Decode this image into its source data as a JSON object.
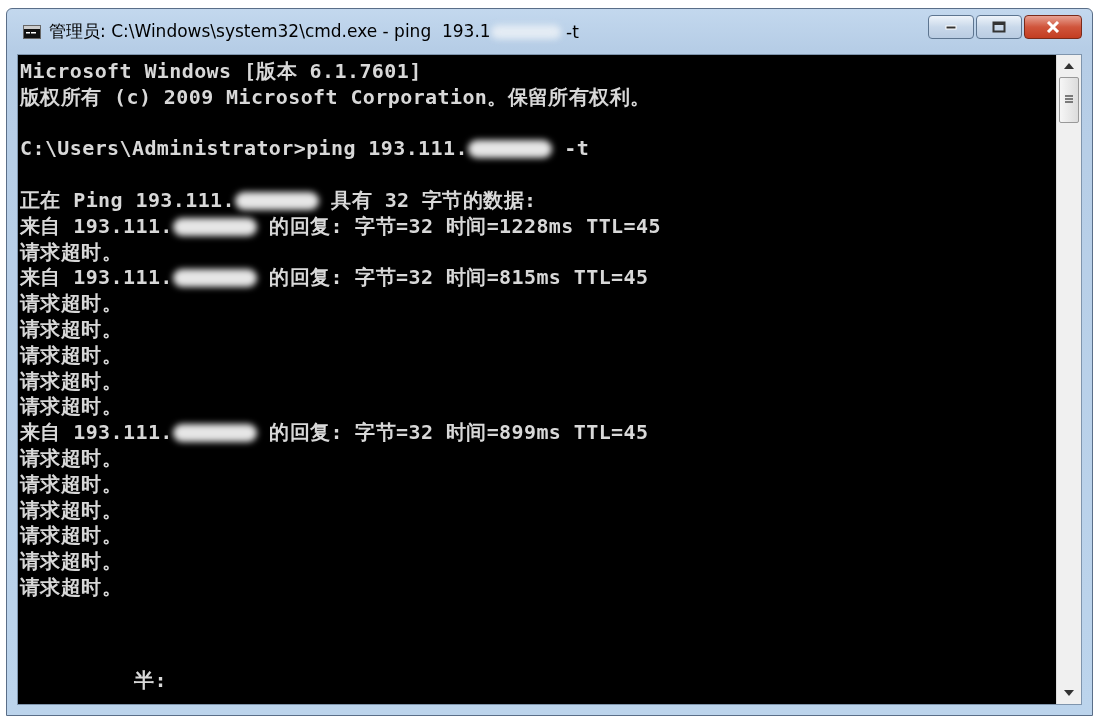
{
  "window": {
    "title": [
      {
        "kind": "text",
        "text": "管理员: C:\\Windows\\system32\\cmd.exe - ping  193.1"
      },
      {
        "kind": "redaction"
      },
      {
        "kind": "text",
        "text": " -t"
      }
    ]
  },
  "console": {
    "lines": [
      {
        "kind": "line",
        "segments": [
          {
            "kind": "text",
            "text": "Microsoft Windows [版本 6.1.7601]"
          }
        ]
      },
      {
        "kind": "line",
        "segments": [
          {
            "kind": "text",
            "text": "版权所有 (c) 2009 Microsoft Corporation。保留所有权利。"
          }
        ]
      },
      {
        "kind": "blank"
      },
      {
        "kind": "line",
        "segments": [
          {
            "kind": "text",
            "text": "C:\\Users\\Administrator>ping 193.111."
          },
          {
            "kind": "redaction"
          },
          {
            "kind": "text",
            "text": " -t"
          }
        ]
      },
      {
        "kind": "blank"
      },
      {
        "kind": "line",
        "segments": [
          {
            "kind": "text",
            "text": "正在 Ping 193.111."
          },
          {
            "kind": "redaction"
          },
          {
            "kind": "text",
            "text": " 具有 32 字节的数据:"
          }
        ]
      },
      {
        "kind": "line",
        "segments": [
          {
            "kind": "text",
            "text": "来自 193.111."
          },
          {
            "kind": "redaction"
          },
          {
            "kind": "text",
            "text": " 的回复: 字节=32 时间=1228ms TTL=45"
          }
        ]
      },
      {
        "kind": "line",
        "segments": [
          {
            "kind": "text",
            "text": "请求超时。"
          }
        ]
      },
      {
        "kind": "line",
        "segments": [
          {
            "kind": "text",
            "text": "来自 193.111."
          },
          {
            "kind": "redaction"
          },
          {
            "kind": "text",
            "text": " 的回复: 字节=32 时间=815ms TTL=45"
          }
        ]
      },
      {
        "kind": "line",
        "segments": [
          {
            "kind": "text",
            "text": "请求超时。"
          }
        ]
      },
      {
        "kind": "line",
        "segments": [
          {
            "kind": "text",
            "text": "请求超时。"
          }
        ]
      },
      {
        "kind": "line",
        "segments": [
          {
            "kind": "text",
            "text": "请求超时。"
          }
        ]
      },
      {
        "kind": "line",
        "segments": [
          {
            "kind": "text",
            "text": "请求超时。"
          }
        ]
      },
      {
        "kind": "line",
        "segments": [
          {
            "kind": "text",
            "text": "请求超时。"
          }
        ]
      },
      {
        "kind": "line",
        "segments": [
          {
            "kind": "text",
            "text": "来自 193.111."
          },
          {
            "kind": "redaction"
          },
          {
            "kind": "text",
            "text": " 的回复: 字节=32 时间=899ms TTL=45"
          }
        ]
      },
      {
        "kind": "line",
        "segments": [
          {
            "kind": "text",
            "text": "请求超时。"
          }
        ]
      },
      {
        "kind": "line",
        "segments": [
          {
            "kind": "text",
            "text": "请求超时。"
          }
        ]
      },
      {
        "kind": "line",
        "segments": [
          {
            "kind": "text",
            "text": "请求超时。"
          }
        ]
      },
      {
        "kind": "line",
        "segments": [
          {
            "kind": "text",
            "text": "请求超时。"
          }
        ]
      },
      {
        "kind": "line",
        "segments": [
          {
            "kind": "text",
            "text": "请求超时。"
          }
        ]
      },
      {
        "kind": "line",
        "segments": [
          {
            "kind": "text",
            "text": "请求超时。"
          }
        ]
      }
    ],
    "ime_status": "半:"
  }
}
